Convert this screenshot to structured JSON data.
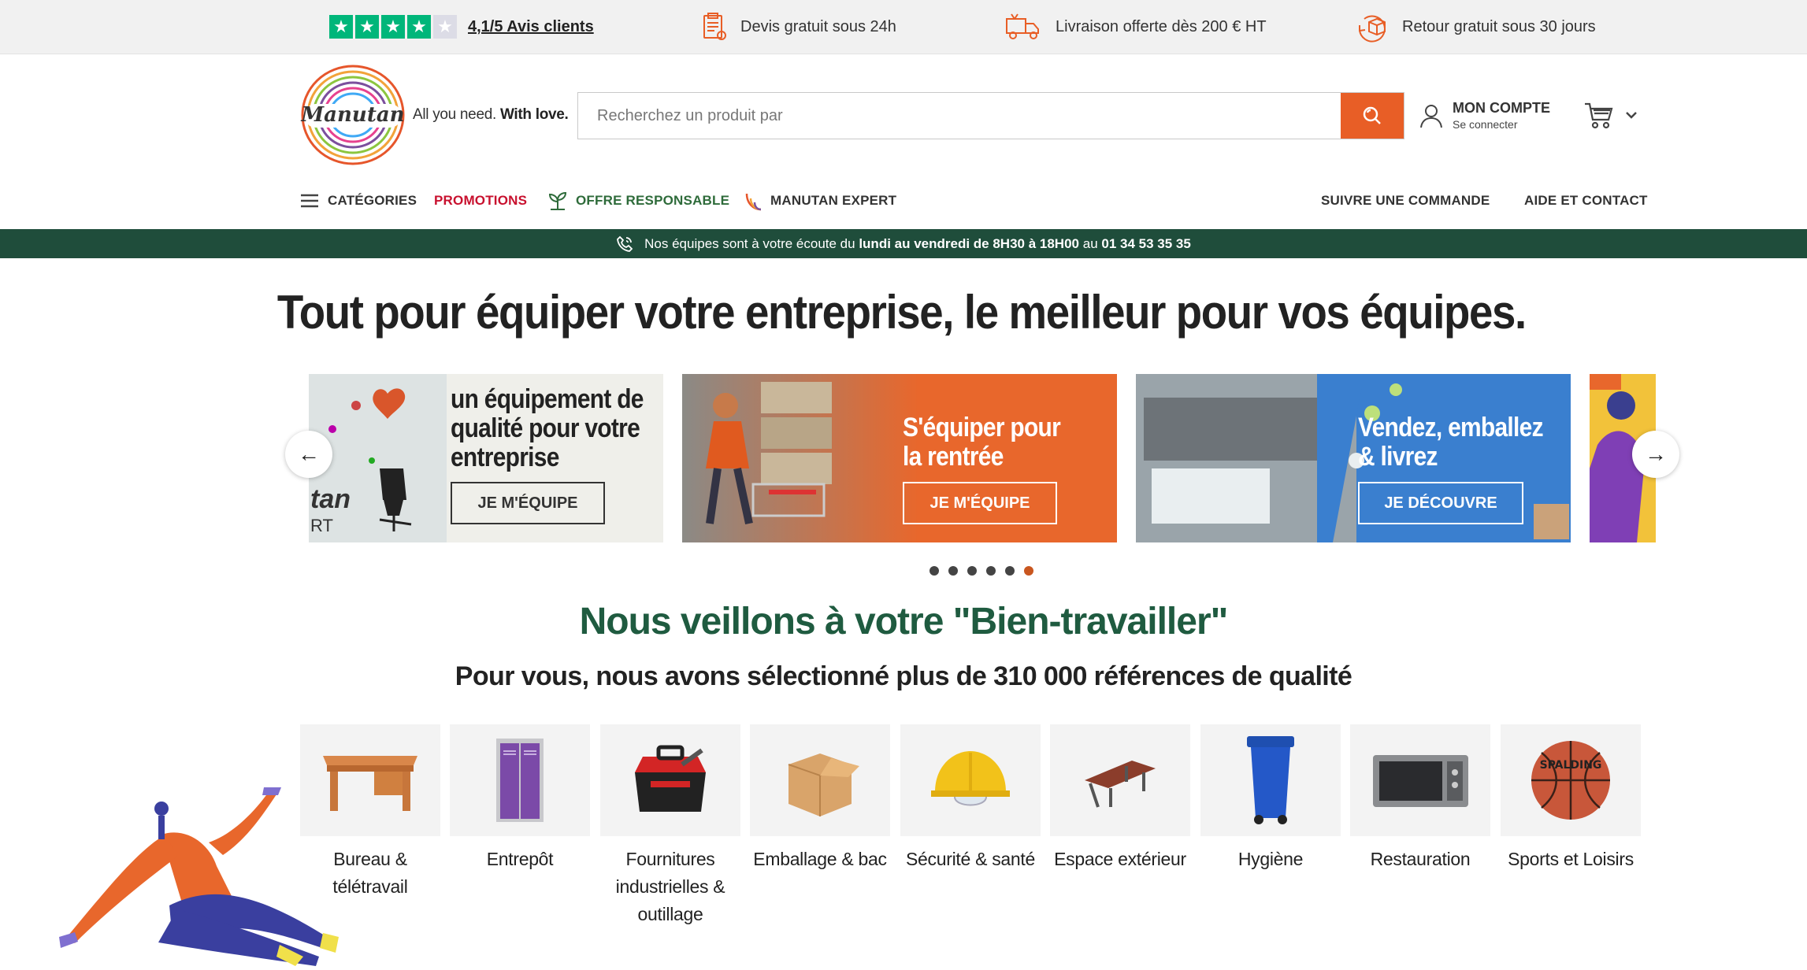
{
  "topbar": {
    "rating": "4,1/5 Avis clients",
    "quote": "Devis gratuit sous 24h",
    "delivery": "Livraison offerte dès 200 € HT",
    "returns": "Retour gratuit sous 30 jours",
    "star_color": "#00b67a"
  },
  "header": {
    "logo_text": "Manutan",
    "tagline_a": "All you need.",
    "tagline_b": "With love.",
    "search_placeholder": "Recherchez un produit par",
    "account_title": "MON COMPTE",
    "account_sub": "Se connecter"
  },
  "nav": {
    "categories": "CATÉGORIES",
    "promotions": "PROMOTIONS",
    "responsible": "OFFRE RESPONSABLE",
    "expert": "MANUTAN EXPERT",
    "track": "SUIVRE UNE COMMANDE",
    "help": "AIDE ET CONTACT"
  },
  "banner": {
    "part1": "Nos équipes sont à votre écoute du",
    "part2": "lundi au vendredi de 8H30 à 18H00",
    "part3": "au",
    "phone": "01 34 53 35 35"
  },
  "hero_title": "Tout pour équiper votre entreprise, le meilleur pour vos équipes.",
  "carousel": {
    "cards": [
      {
        "title": "un équipement de qualité pour votre entreprise",
        "cta": "JE M'ÉQUIPE",
        "image_text": "tan\nRT"
      },
      {
        "title": "S'équiper pour la rentrée",
        "cta": "JE M'ÉQUIPE"
      },
      {
        "title": "Vendez, emballez & livrez",
        "cta": "JE DÉCOUVRE"
      }
    ],
    "dots_total": 6,
    "active_dot": 6
  },
  "section": {
    "title": "Nous veillons à votre \"Bien-travailler\"",
    "subtitle": "Pour vous, nous avons sélectionné plus de 310 000 références de qualité"
  },
  "categories": [
    {
      "label": "Bureau & télétravail",
      "icon": "desk-icon"
    },
    {
      "label": "Entrepôt",
      "icon": "locker-icon"
    },
    {
      "label": "Fournitures industrielles & outillage",
      "icon": "toolbox-icon"
    },
    {
      "label": "Emballage & bac",
      "icon": "box-icon"
    },
    {
      "label": "Sécurité & santé",
      "icon": "helmet-icon"
    },
    {
      "label": "Espace extérieur",
      "icon": "bench-icon"
    },
    {
      "label": "Hygiène",
      "icon": "bin-icon"
    },
    {
      "label": "Restauration",
      "icon": "microwave-icon"
    },
    {
      "label": "Sports et Loisirs",
      "icon": "basketball-icon"
    }
  ],
  "colors": {
    "accent": "#e85e26",
    "banner": "#1f4d3b",
    "title_green": "#1f5b40",
    "promo_red": "#c8102e",
    "responsible_green": "#2e6b3a"
  }
}
